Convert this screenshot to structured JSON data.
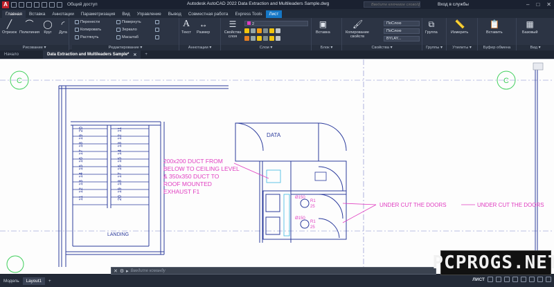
{
  "app": {
    "logo_letter": "A",
    "share_label": "Общий доступ",
    "title": "Autodesk AutoCAD 2022   Data Extraction and Multileaders Sample.dwg",
    "search_placeholder": "Введите ключевое слово/фразу",
    "signin_label": "Вход в службы",
    "window_buttons": [
      "–",
      "□",
      "✕"
    ]
  },
  "ribbon_tabs": [
    {
      "label": "Главная",
      "state": "active"
    },
    {
      "label": "Вставка",
      "state": ""
    },
    {
      "label": "Аннотации",
      "state": ""
    },
    {
      "label": "Параметризация",
      "state": ""
    },
    {
      "label": "Вид",
      "state": ""
    },
    {
      "label": "Управление",
      "state": ""
    },
    {
      "label": "Вывод",
      "state": ""
    },
    {
      "label": "Совместная работа",
      "state": ""
    },
    {
      "label": "Express Tools",
      "state": ""
    },
    {
      "label": "Лист",
      "state": "hl"
    }
  ],
  "ribbon": {
    "draw": {
      "label": "Рисование ▾",
      "buttons": [
        "Отрезок",
        "Полилиния",
        "Круг",
        "Дуга"
      ]
    },
    "modify": {
      "label": "Редактирование ▾",
      "buttons": [
        "Перенести",
        "Повернуть",
        "Копировать",
        "Зеркало",
        "Растянуть",
        "Масштаб"
      ]
    },
    "annotation": {
      "label": "Аннотации ▾",
      "buttons": [
        "Текст",
        "Размер"
      ]
    },
    "layers": {
      "label": "Слои ▾",
      "button": "Свойства слоя",
      "current_layer": "2"
    },
    "block": {
      "label": "Блок ▾",
      "button": "Вставка"
    },
    "properties": {
      "label": "Свойства ▾",
      "button": "Копирование свойств",
      "color": "ПоСлою",
      "linetype": "ПоСлою",
      "lineweight": "BYLAY..."
    },
    "groups": {
      "label": "Группы ▾",
      "button": "Группа"
    },
    "utilities": {
      "label": "Утилиты ▾",
      "button": "Измерить"
    },
    "clipboard": {
      "label": "Буфер обмена",
      "button": "Вставить"
    },
    "view": {
      "label": "Вид ▾",
      "button": "Базовый"
    }
  },
  "doc_tabs": [
    {
      "label": "Начало",
      "active": false
    },
    {
      "label": "Data Extraction and Multileaders Sample*",
      "active": true
    }
  ],
  "drawing": {
    "grid_left": "C",
    "grid_right": "C",
    "room_label": "DATA",
    "landing_label": "LANDING",
    "stair_numbers": [
      "20",
      "19",
      "18",
      "17",
      "16",
      "15",
      "14",
      "13",
      "12",
      "11"
    ],
    "duct_note": [
      "200x200 DUCT FROM",
      "BELOW TO CEILING LEVEL",
      "& 350x350 DUCT TO",
      "ROOF MOUNTED",
      "EXHAUST F1"
    ],
    "undercut_note_1": "UNDER CUT THE DOORS",
    "undercut_note_2": "UNDER CUT THE DOORS",
    "tag_ø150": "Ø150",
    "tag_r1": "R1",
    "tag_25": "25"
  },
  "command_line": {
    "placeholder": "Введите команду"
  },
  "layout_tabs": [
    {
      "label": "Модель",
      "active": false
    },
    {
      "label": "Layout1",
      "active": true
    }
  ],
  "status": {
    "mode_label": "ЛИСТ"
  },
  "watermark": "PCPROGS.NET",
  "colors": {
    "magenta": "#e03cc0",
    "cad_blue": "#2a3a9c",
    "grid_green": "#3ecf5a",
    "accent": "#1577c6"
  }
}
